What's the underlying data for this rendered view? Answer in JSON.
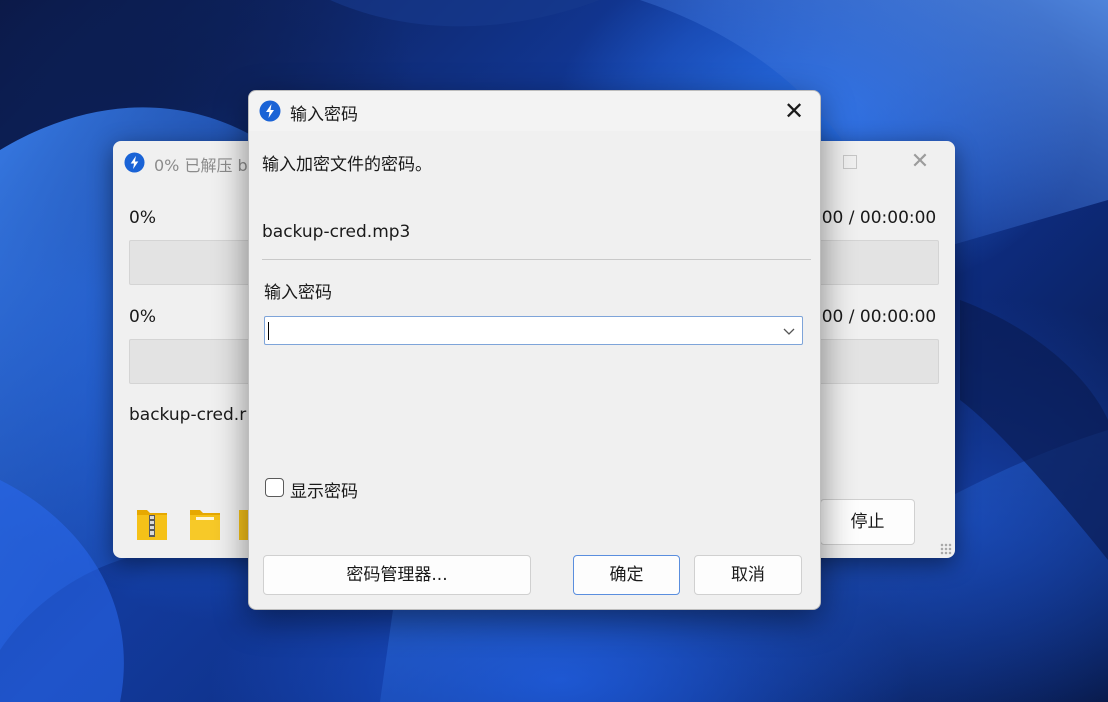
{
  "progress_window": {
    "title": "0% 已解压 b",
    "percent_top": "0%",
    "time_top": ":00 / 00:00:00",
    "percent_bottom": "0%",
    "time_bottom": ":00 / 00:00:00",
    "current_file": "backup-cred.r",
    "stop_label": "停止"
  },
  "password_dialog": {
    "title": "输入密码",
    "prompt": "输入加密文件的密码。",
    "filename": "backup-cred.mp3",
    "password_label": "输入密码",
    "password_value": "",
    "show_password_label": "显示密码",
    "buttons": {
      "password_manager": "密码管理器...",
      "ok": "确定",
      "cancel": "取消"
    }
  },
  "icons": [
    "bandizip-app-icon",
    "zip-folder-icon",
    "folder-icon",
    "close-icon",
    "maximize-icon",
    "chevron-down-icon"
  ],
  "colors": {
    "accent": "#1a63d6",
    "folder": "#f5c118",
    "dialog_bg": "#f0f0f0"
  }
}
